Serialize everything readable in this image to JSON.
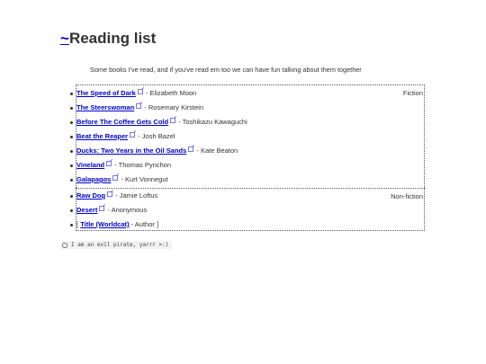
{
  "header": {
    "home_link": "~",
    "title": "Reading list"
  },
  "intro": "Some books I've read, and if you've read em too we can have fun talking about them together",
  "fiction": {
    "label": "Fiction",
    "books": [
      {
        "title": "The Speed of Dark",
        "author": "Elizabeth Moon"
      },
      {
        "title": "The Steerswoman",
        "author": "Rosemary Kirstein"
      },
      {
        "title": "Before The Coffee Gets Cold",
        "author": "Toshikazu Kawaguchi"
      },
      {
        "title": "Beat the Reaper",
        "author": "Josh Bazel"
      },
      {
        "title": "Ducks: Two Years in the Oil Sands",
        "author": "Kate Beaton"
      },
      {
        "title": "Vineland",
        "author": "Thomas Pynchon"
      },
      {
        "title": "Galapagos",
        "author": "Kurt Vonnegut"
      }
    ]
  },
  "nonfiction": {
    "label": "Non-fiction",
    "books": [
      {
        "title": "Raw Dog",
        "author": "Jamie Loftus"
      },
      {
        "title": "Desert",
        "author": "Anonymous"
      }
    ],
    "placeholder": {
      "open": "[",
      "title": "Title (Worldcat)",
      "sep": " - ",
      "author": "Author",
      "close": "]"
    }
  },
  "pirate_toggle": {
    "label": "I am an evil pirate, yarrr >:)",
    "checked": false
  },
  "separator": " - ",
  "colors": {
    "link": "#0000cc",
    "text": "#333333",
    "border": "#555555"
  },
  "icons": {
    "external_link": "external-link-icon",
    "bullet": "bullet"
  }
}
